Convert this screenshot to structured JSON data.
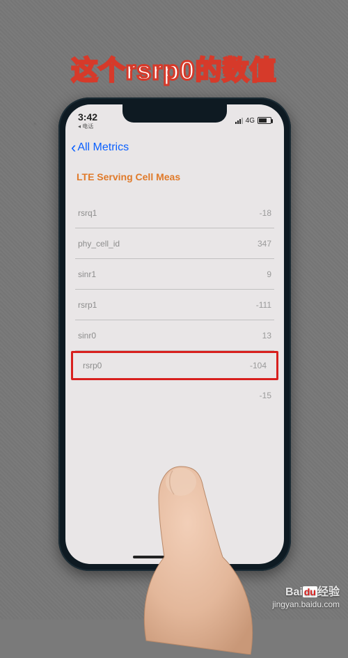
{
  "overlay_text": "这个rsrp0的数值",
  "status": {
    "time": "3:42",
    "sub": "◂ 电话",
    "network": "4G"
  },
  "nav": {
    "back_label": "All Metrics"
  },
  "section_title": "LTE Serving Cell Meas",
  "metrics": [
    {
      "label": "rsrq1",
      "value": "-18"
    },
    {
      "label": "phy_cell_id",
      "value": "347"
    },
    {
      "label": "sinr1",
      "value": "9"
    },
    {
      "label": "rsrp1",
      "value": "-111"
    },
    {
      "label": "sinr0",
      "value": "13"
    },
    {
      "label": "rsrp0",
      "value": "-104"
    },
    {
      "label": "",
      "value": "-15"
    }
  ],
  "highlight_index": 5,
  "watermark": {
    "brand_prefix": "Bai",
    "brand_box": "du",
    "brand_suffix": "经验",
    "url": "jingyan.baidu.com"
  }
}
